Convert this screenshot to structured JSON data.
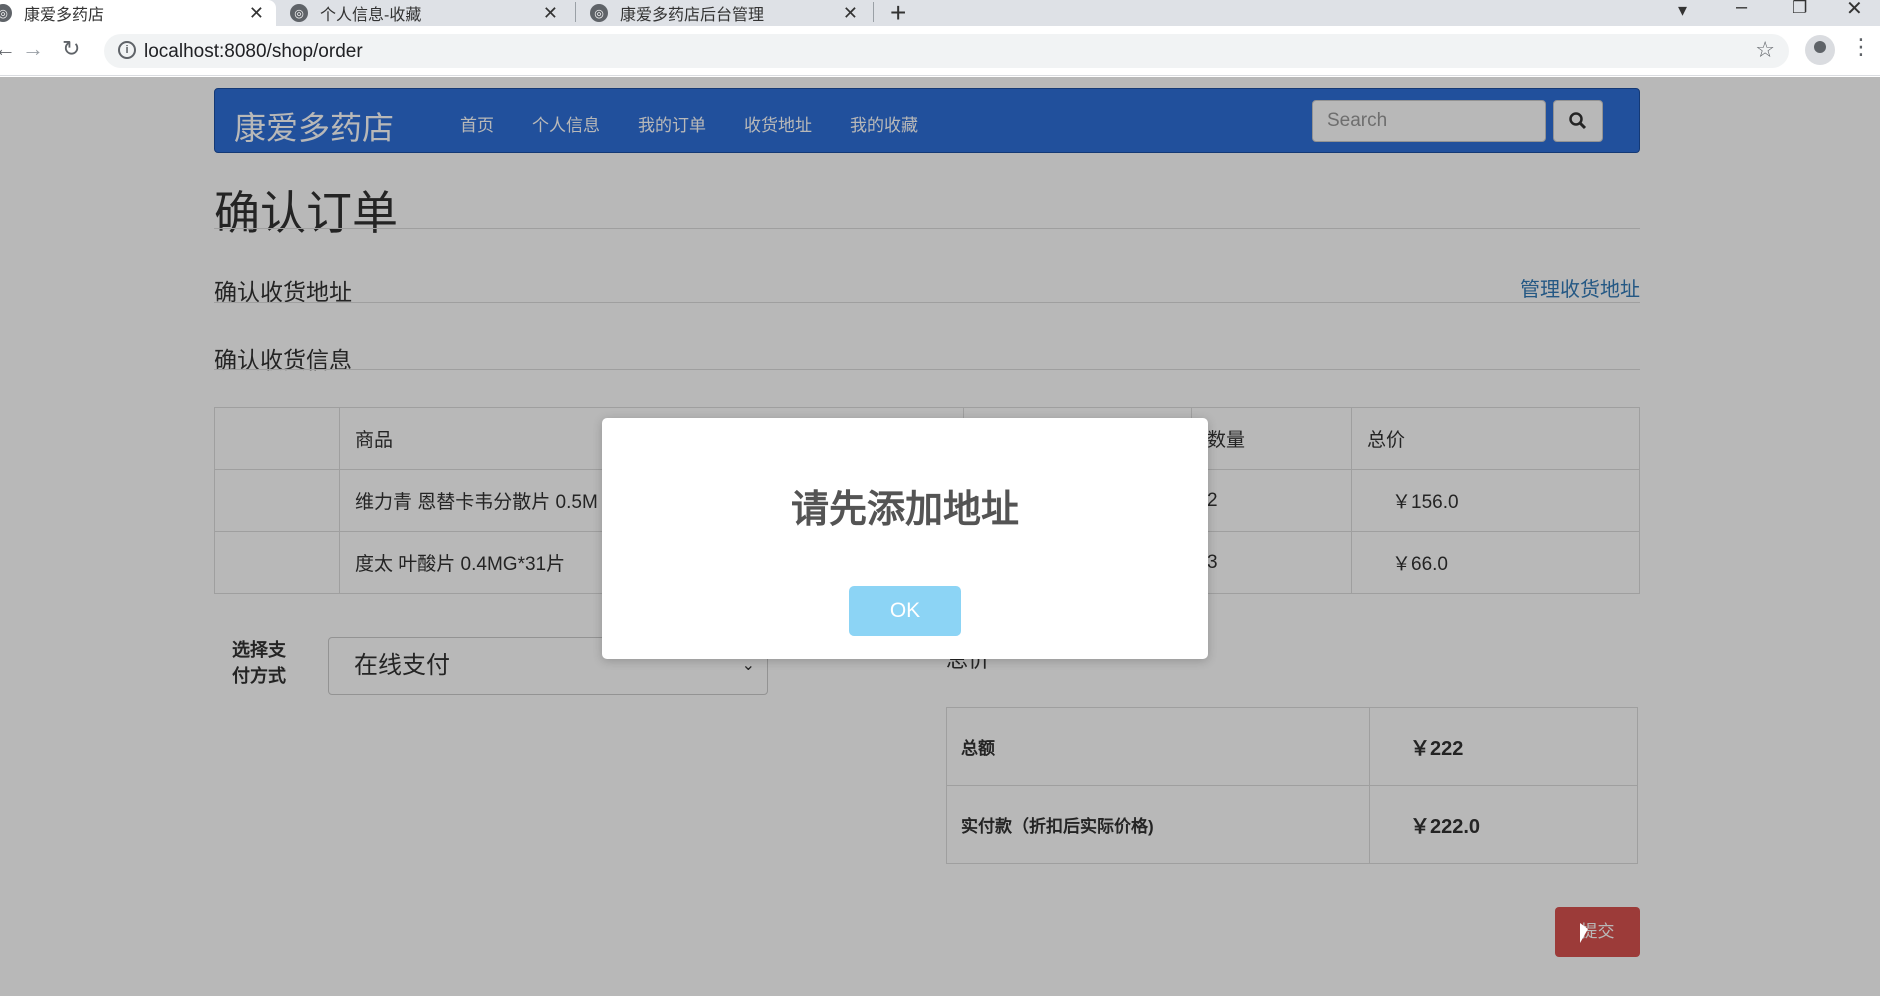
{
  "browser": {
    "tabs": [
      {
        "title": "康爱多药店",
        "active": true
      },
      {
        "title": "个人信息-收藏",
        "active": false
      },
      {
        "title": "康爱多药店后台管理",
        "active": false
      }
    ],
    "url": "localhost:8080/shop/order"
  },
  "navbar": {
    "brand": "康爱多药店",
    "links": [
      "首页",
      "个人信息",
      "我的订单",
      "收货地址",
      "我的收藏"
    ],
    "search_placeholder": "Search"
  },
  "page": {
    "title": "确认订单",
    "address_heading": "确认收货地址",
    "manage_address": "管理收货地址",
    "info_heading": "确认收货信息"
  },
  "items_table": {
    "headers": [
      "",
      "商品",
      "",
      "数量",
      "总价"
    ],
    "rows": [
      {
        "name": "维力青 恩替卡韦分散片 0.5M",
        "qty": "2",
        "total": "￥156.0"
      },
      {
        "name": "度太 叶酸片 0.4MG*31片",
        "qty": "3",
        "total": "￥66.0"
      }
    ]
  },
  "payment": {
    "label": "选择支付方式",
    "selected": "在线支付"
  },
  "summary": {
    "heading": "总价",
    "rows": [
      {
        "label": "总额",
        "value": "￥222"
      },
      {
        "label": "实付款（折扣后实际价格)",
        "value": "￥222.0"
      }
    ]
  },
  "submit_label": "提交",
  "dialog": {
    "message": "请先添加地址",
    "ok_label": "OK"
  },
  "colors": {
    "navbar": "#2f6fd8",
    "ok_button": "#8cd4f5",
    "submit_button": "#d9534f"
  }
}
